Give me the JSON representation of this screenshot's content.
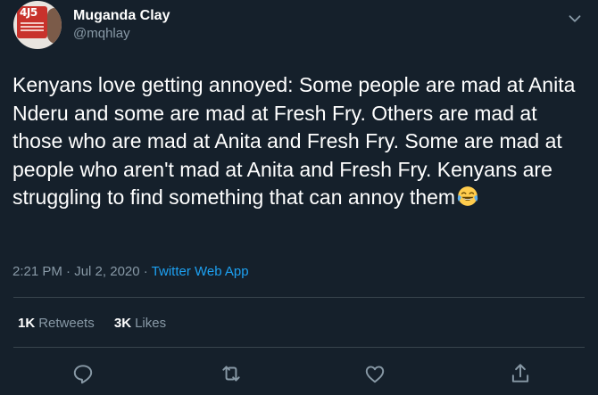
{
  "user": {
    "display_name": "Muganda Clay",
    "handle": "@mqhlay",
    "avatar_sign_text": "4J5"
  },
  "tweet": {
    "text": "Kenyans love getting annoyed: Some people are mad at Anita Nderu and some are mad at Fresh Fry. Others are mad at those who are mad at Anita and Fresh Fry. Some are mad at people who aren't mad at Anita and Fresh Fry. Kenyans are struggling to find something that can annoy them",
    "emoji": "face-with-tears-of-joy-icon"
  },
  "meta": {
    "time": "2:21 PM",
    "separator1": " · ",
    "date": "Jul 2, 2020",
    "separator2": " · ",
    "source": "Twitter Web App"
  },
  "stats": {
    "retweets_count": "1K",
    "retweets_label": "Retweets",
    "likes_count": "3K",
    "likes_label": "Likes"
  },
  "actions": [
    "reply-icon",
    "retweet-icon",
    "like-icon",
    "share-icon"
  ],
  "colors": {
    "background": "#15202b",
    "text": "#ffffff",
    "secondary": "#8899a6",
    "link": "#1da1f2",
    "divider": "#38444d"
  }
}
